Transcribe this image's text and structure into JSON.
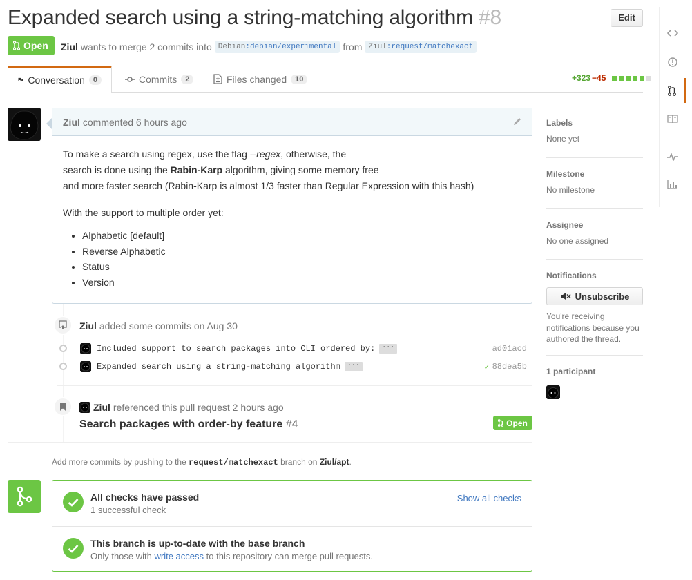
{
  "header": {
    "title": "Expanded search using a string-matching algorithm",
    "number": "#8",
    "edit_label": "Edit",
    "state": "Open",
    "author": "Ziul",
    "meta_text": "wants to merge 2 commits into",
    "base_user": "Debian",
    "base_branch": ":debian/experimental",
    "from_text": "from",
    "head_user": "Ziul",
    "head_branch": ":request/matchexact"
  },
  "tabs": [
    {
      "label": "Conversation",
      "count": "0"
    },
    {
      "label": "Commits",
      "count": "2"
    },
    {
      "label": "Files changed",
      "count": "10"
    }
  ],
  "diffstat": {
    "additions": "+323",
    "deletions": "−45",
    "blocks_green": 5,
    "blocks_total": 6
  },
  "rail_icons": [
    "code-icon",
    "issue-icon",
    "pull-request-icon",
    "wiki-icon",
    "pulse-icon",
    "graphs-icon"
  ],
  "comment": {
    "author": "Ziul",
    "action": "commented 6 hours ago",
    "line1_pre": "To make a search using regex, use the flag --",
    "line1_em": "regex",
    "line1_post": ", otherwise, the",
    "line2_pre": "search is done using the ",
    "line2_strong": "Rabin-Karp",
    "line2_post": " algorithm, giving some memory free",
    "line3": "and more faster search (Rabin-Karp is almost 1/3 faster than Regular Expression with this hash)",
    "para2": "With the support to multiple order yet:",
    "list": [
      "Alphabetic [default]",
      "Reverse Alphabetic",
      "Status",
      "Version"
    ]
  },
  "commits_event": {
    "author": "Ziul",
    "text": "added some commits on Aug 30",
    "commits": [
      {
        "message": "Included support to search packages into CLI ordered by:",
        "sha": "ad01acd",
        "verified": false
      },
      {
        "message": "Expanded search using a string-matching algorithm",
        "sha": "88dea5b",
        "verified": true
      }
    ]
  },
  "reference_event": {
    "author": "Ziul",
    "text": "referenced this pull request 2 hours ago",
    "title": "Search packages with order-by feature",
    "number": "#4",
    "state": "Open"
  },
  "push_hint": {
    "pre": "Add more commits by pushing to the",
    "branch": "request/matchexact",
    "mid": "branch on",
    "repo": "Ziul/apt",
    "post": "."
  },
  "merge": {
    "checks_title": "All checks have passed",
    "checks_sub": "1 successful check",
    "show_checks": "Show all checks",
    "branch_title": "This branch is up-to-date with the base branch",
    "branch_sub_pre": "Only those with",
    "branch_sub_link": "write access",
    "branch_sub_post": "to this repository can merge pull requests."
  },
  "sidebar": {
    "labels_h": "Labels",
    "labels_v": "None yet",
    "milestone_h": "Milestone",
    "milestone_v": "No milestone",
    "assignee_h": "Assignee",
    "assignee_v": "No one assigned",
    "notifications_h": "Notifications",
    "unsubscribe": "Unsubscribe",
    "notif_reason": "You're receiving notifications because you authored the thread.",
    "participants_h": "1 participant"
  },
  "colors": {
    "open_green": "#6cc644",
    "accent_orange": "#d26911",
    "link_blue": "#4078c0",
    "deletion_red": "#bd2c00"
  }
}
